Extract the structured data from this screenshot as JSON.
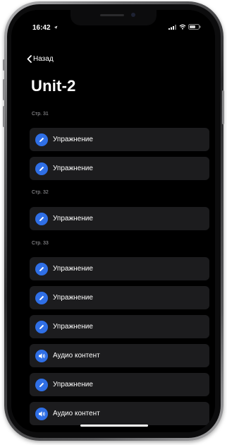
{
  "status_bar": {
    "time": "16:42"
  },
  "nav": {
    "back_label": "Назад"
  },
  "page": {
    "title": "Unit-2"
  },
  "sections": [
    {
      "label": "Стр. 31",
      "items": [
        {
          "label": "Упражнение",
          "icon": "pencil-icon"
        },
        {
          "label": "Упражнение",
          "icon": "pencil-icon"
        }
      ]
    },
    {
      "label": "Стр. 32",
      "items": [
        {
          "label": "Упражнение",
          "icon": "pencil-icon"
        }
      ]
    },
    {
      "label": "Стр. 33",
      "items": [
        {
          "label": "Упражнение",
          "icon": "pencil-icon"
        },
        {
          "label": "Упражнение",
          "icon": "pencil-icon"
        },
        {
          "label": "Упражнение",
          "icon": "pencil-icon"
        },
        {
          "label": "Аудио контент",
          "icon": "speaker-icon"
        },
        {
          "label": "Упражнение",
          "icon": "pencil-icon"
        },
        {
          "label": "Аудио контент",
          "icon": "speaker-icon"
        }
      ]
    }
  ],
  "colors": {
    "accent": "#2f6fe6",
    "row_background": "#1c1c1e",
    "screen_background": "#000000"
  }
}
